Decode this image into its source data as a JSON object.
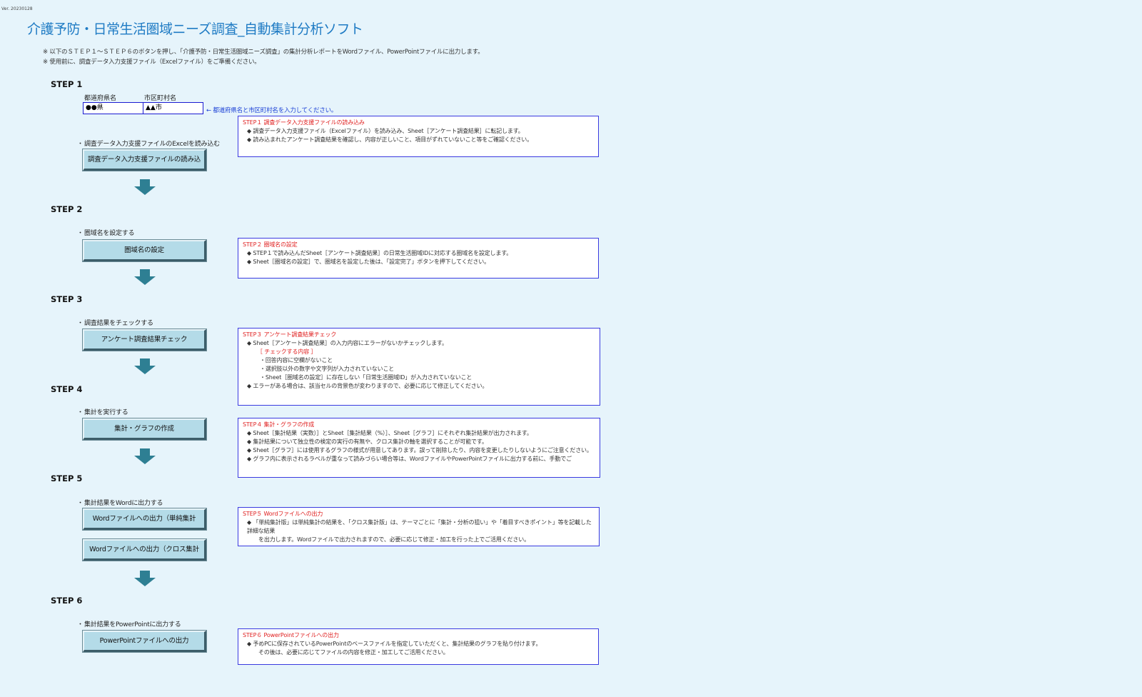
{
  "version": "Ver. 20230128",
  "title": "介護予防・日常生活圏域ニーズ調査_自動集計分析ソフト",
  "notes": [
    "※ 以下のＳＴＥＰ１～ＳＴＥＰ６のボタンを押し、「介護予防・日常生活圏域ニーズ調査」の集計分析レポートをWordファイル、PowerPointファイルに出力します。",
    "※ 使用前に、調査データ入力支援ファイル（Excelファイル）をご準備ください。"
  ],
  "step1": {
    "heading": "STEP 1",
    "prefecture_label": "都道府県名",
    "city_label": "市区町村名",
    "prefecture_value": "●●県",
    "city_value": "▲▲市",
    "hint": "← 都道府県名と市区町村名を入力してください。",
    "bullet": "調査データ入力支援ファイルのExcelを読み込む",
    "button": "調査データ入力支援ファイルの読み込",
    "box": {
      "title": "STEP１ 調査データ入力支援ファイルの読み込み",
      "lines": [
        "◆ 調査データ入力支援ファイル（Excelファイル）を読み込み、Sheet［アンケート調査結果］に転記します。",
        "◆ 読み込まれたアンケート調査結果を確認し、内容が正しいこと、項目がずれていないこと等をご確認ください。"
      ]
    }
  },
  "step2": {
    "heading": "STEP 2",
    "bullet": "圏域名を設定する",
    "button": "圏域名の設定",
    "box": {
      "title": "STEP２ 圏域名の設定",
      "lines": [
        "◆ STEP１で読み込んだSheet［アンケート調査結果］の日常生活圏域IDに対応する圏域名を設定します。",
        "◆ Sheet［圏域名の設定］で、圏域名を設定した後は、「設定完了」ボタンを押下してください。"
      ]
    }
  },
  "step3": {
    "heading": "STEP 3",
    "bullet": "調査結果をチェックする",
    "button": "アンケート調査結果チェック",
    "box": {
      "title": "STEP３ アンケート調査結果チェック",
      "line1": "◆ Sheet［アンケート調査結果］の入力内容にエラーがないかチェックします。",
      "sub": "［ チェックする内容 ］",
      "checks": [
        "・回答内容に空欄がないこと",
        "・選択肢以外の数字や文字列が入力されていないこと",
        "・Sheet［圏域名の設定］に存在しない「日常生活圏域ID」が入力されていないこと"
      ],
      "line2": "◆ エラーがある場合は、該当セルの背景色が変わりますので、必要に応じて修正してください。"
    }
  },
  "step4": {
    "heading": "STEP 4",
    "bullet": "集計を実行する",
    "button": "集計・グラフの作成",
    "box": {
      "title": "STEP４ 集計・グラフの作成",
      "lines": [
        "◆ Sheet［集計結果（実数）］とSheet［集計結果（%）］、Sheet［グラフ］にそれぞれ集計結果が出力されます。",
        "◆ 集計結果について独立性の検定の実行の有無や、クロス集計の軸を選択することが可能です。",
        "◆ Sheet［グラフ］には使用するグラフの様式が用意してあります。誤って削除したり、内容を変更したりしないようにご注意ください。",
        "◆ グラフ内に表示されるラベルが重なって読みづらい場合等は、WordファイルやPowerPointファイルに出力する前に、手動でご"
      ]
    }
  },
  "step5": {
    "heading": "STEP 5",
    "bullet": "集計結果をWordに出力する",
    "button_simple": "Wordファイルへの出力（単純集計",
    "button_cross": "Wordファイルへの出力（クロス集計",
    "box": {
      "title": "STEP５ Wordファイルへの出力",
      "line1": "◆ 「単純集計版」は単純集計の結果を、「クロス集計版」は、テーマごとに「集計・分析の狙い」や「着目すべきポイント」等を記載した詳細な結果",
      "line2": "を出力します。Wordファイルで出力されますので、必要に応じて修正・加工を行った上でご活用ください。"
    }
  },
  "step6": {
    "heading": "STEP 6",
    "bullet": "集計結果をPowerPointに出力する",
    "button": "PowerPointファイルへの出力",
    "box": {
      "title": "STEP６ PowerPointファイルへの出力",
      "line1": "◆ 予めPCに保存されているPowerPointのベースファイルを指定していただくと、集計結果のグラフを貼り付けます。",
      "line2": "その後は、必要に応じてファイルの内容を修正・加工してご活用ください。"
    }
  },
  "colors": {
    "background": "#e6f4fb",
    "title": "#1f7bc4",
    "button": "#b4dbe8",
    "arrow": "#2e7f93",
    "box_title": "#e02020",
    "box_border": "#3a3ae0",
    "hint": "#1a3fd6"
  }
}
